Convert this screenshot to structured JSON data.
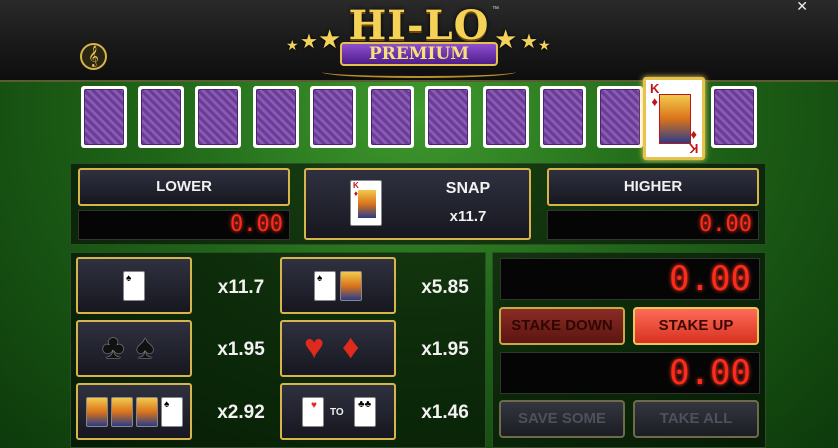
{
  "logo": {
    "title": "HI-LO",
    "tm": "™",
    "subtitle": "PREMIUM"
  },
  "topbar": {
    "corner": "✕"
  },
  "icons": {
    "music": "treble-clef-icon"
  },
  "current_card": {
    "rank": "K",
    "suit": "♦"
  },
  "predictions": {
    "lower": {
      "label": "LOWER",
      "value": "0.00"
    },
    "snap": {
      "label": "SNAP",
      "multiplier": "x11.7",
      "card_rank": "K",
      "card_suit": "♦"
    },
    "higher": {
      "label": "HIGHER",
      "value": "0.00"
    }
  },
  "side_bets": [
    {
      "id": "ace",
      "multiplier": "x11.7"
    },
    {
      "id": "pair",
      "multiplier": "x5.85"
    },
    {
      "id": "black",
      "multiplier": "x1.95"
    },
    {
      "id": "red",
      "multiplier": "x1.95"
    },
    {
      "id": "picture",
      "multiplier": "x2.92"
    },
    {
      "id": "range",
      "to_text": "TO",
      "multiplier": "x1.46"
    }
  ],
  "stake_panel": {
    "stake_value": "0.00",
    "stake_down": "STAKE DOWN",
    "stake_up": "STAKE UP",
    "win_value": "0.00",
    "save_some": "SAVE SOME",
    "take_all": "TAKE ALL"
  },
  "colors": {
    "gold": "#d8b54a",
    "led": "#ff2a1a",
    "felt": "#1f6518",
    "stake_up": "#e8473a",
    "stake_down": "#7a1f1a"
  }
}
